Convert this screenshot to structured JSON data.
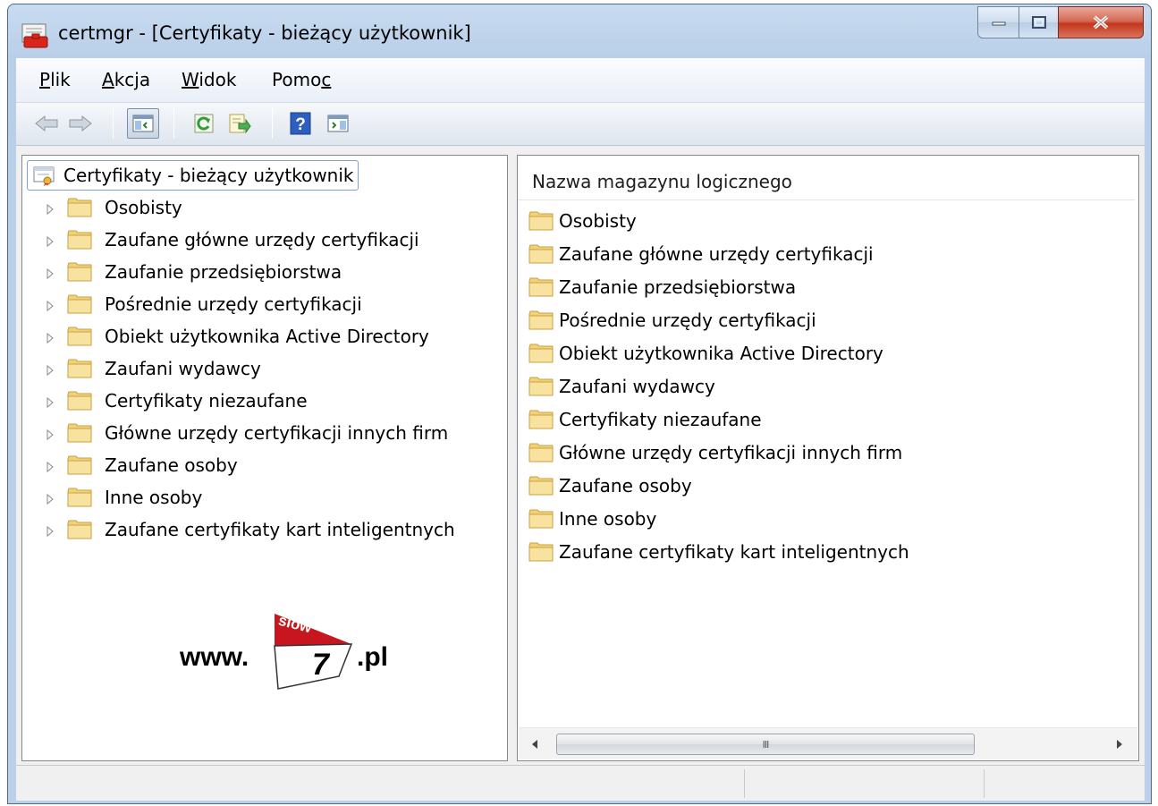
{
  "window": {
    "title": "certmgr - [Certyfikaty - bieżący użytkownik]"
  },
  "menu": [
    {
      "label": "Plik",
      "accel": "P",
      "rest": "lik"
    },
    {
      "label": "Akcja",
      "accel": "A",
      "rest": "kcja"
    },
    {
      "label": "Widok",
      "accel": "W",
      "rest": "idok"
    },
    {
      "label": "Pomoc",
      "pre": "Pomo",
      "accel": "c"
    }
  ],
  "toolbar": {
    "icons": [
      "back-arrow-icon",
      "forward-arrow-icon",
      "show-hide-console-tree-icon",
      "refresh-icon",
      "export-list-icon",
      "help-icon",
      "show-hide-action-pane-icon"
    ]
  },
  "tree": {
    "root": "Certyfikaty - bieżący użytkownik",
    "items": [
      "Osobisty",
      "Zaufane główne urzędy certyfikacji",
      "Zaufanie przedsiębiorstwa",
      "Pośrednie urzędy certyfikacji",
      "Obiekt użytkownika Active Directory",
      "Zaufani wydawcy",
      "Certyfikaty niezaufane",
      "Główne urzędy certyfikacji innych firm",
      "Zaufane osoby",
      "Inne osoby",
      "Zaufane certyfikaty kart inteligentnych"
    ]
  },
  "list": {
    "column_header": "Nazwa magazynu logicznego",
    "items": [
      "Osobisty",
      "Zaufane główne urzędy certyfikacji",
      "Zaufanie przedsiębiorstwa",
      "Pośrednie urzędy certyfikacji",
      "Obiekt użytkownika Active Directory",
      "Zaufani wydawcy",
      "Certyfikaty niezaufane",
      "Główne urzędy certyfikacji innych firm",
      "Zaufane osoby",
      "Inne osoby",
      "Zaufane certyfikaty kart inteligentnych"
    ],
    "scroll_thumb_label": "III"
  },
  "watermark": {
    "prefix": "www.",
    "slow": "slow",
    "seven": "7",
    "suffix": ".pl"
  },
  "colors": {
    "folder": "#f2d179",
    "titlebar": "#c8dbf0",
    "close_button": "#c2371d"
  }
}
